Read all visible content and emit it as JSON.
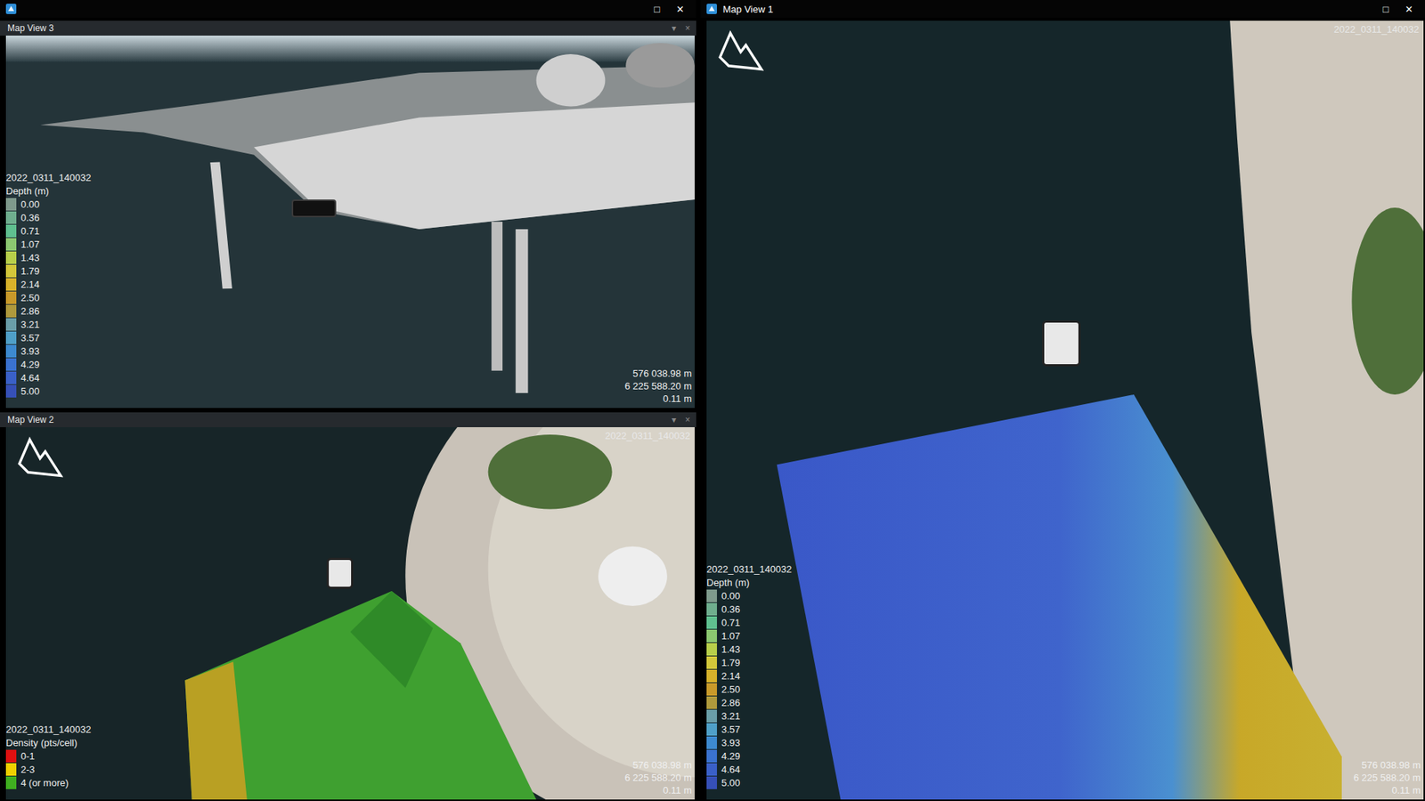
{
  "windows": [
    {
      "title": "",
      "buttons": [
        "□",
        "✕"
      ],
      "panels": [
        {
          "title": "Map View 3",
          "kind": "perspective",
          "controls": [
            "▾",
            "×"
          ],
          "top_tag": "",
          "north_arrow": false,
          "legend": {
            "dataset": "2022_0311_140032",
            "title": "Depth (m)",
            "entries": [
              {
                "label": "0.00",
                "color": "#7f9a8c"
              },
              {
                "label": "0.36",
                "color": "#6fae8e"
              },
              {
                "label": "0.71",
                "color": "#5fc08f"
              },
              {
                "label": "1.07",
                "color": "#8cc870"
              },
              {
                "label": "1.43",
                "color": "#b8cf4a"
              },
              {
                "label": "1.79",
                "color": "#d4c83a"
              },
              {
                "label": "2.14",
                "color": "#d8b22a"
              },
              {
                "label": "2.50",
                "color": "#c99a2a"
              },
              {
                "label": "2.86",
                "color": "#b09a3c"
              },
              {
                "label": "3.21",
                "color": "#6a9ea8"
              },
              {
                "label": "3.57",
                "color": "#4fa0c8"
              },
              {
                "label": "3.93",
                "color": "#3d8ad0"
              },
              {
                "label": "4.29",
                "color": "#3a72d0"
              },
              {
                "label": "4.64",
                "color": "#3a60c8"
              },
              {
                "label": "5.00",
                "color": "#3650b8"
              }
            ]
          },
          "coords": [
            "576 038.98 m",
            "6 225 588.20 m",
            "0.11 m"
          ]
        },
        {
          "title": "Map View 2",
          "kind": "plan-density",
          "controls": [
            "▾",
            "×"
          ],
          "top_tag": "2022_0311_140032",
          "north_arrow": true,
          "legend": {
            "dataset": "2022_0311_140032",
            "title": "Density (pts/cell)",
            "entries": [
              {
                "label": "0-1",
                "color": "#e01010"
              },
              {
                "label": "2-3",
                "color": "#f0d000"
              },
              {
                "label": "4 (or more)",
                "color": "#40b020"
              }
            ]
          },
          "coords": [
            "576 038.98 m",
            "6 225 588.20 m",
            "0.11 m"
          ]
        }
      ]
    },
    {
      "title": "Map View 1",
      "buttons": [
        "□",
        "✕"
      ],
      "panels": [
        {
          "title": "",
          "kind": "plan-depth",
          "controls": [],
          "top_tag": "2022_0311_140032",
          "north_arrow": true,
          "legend": {
            "dataset": "2022_0311_140032",
            "title": "Depth (m)",
            "entries": [
              {
                "label": "0.00",
                "color": "#7f9a8c"
              },
              {
                "label": "0.36",
                "color": "#6fae8e"
              },
              {
                "label": "0.71",
                "color": "#5fc08f"
              },
              {
                "label": "1.07",
                "color": "#8cc870"
              },
              {
                "label": "1.43",
                "color": "#b8cf4a"
              },
              {
                "label": "1.79",
                "color": "#d4c83a"
              },
              {
                "label": "2.14",
                "color": "#d8b22a"
              },
              {
                "label": "2.50",
                "color": "#c99a2a"
              },
              {
                "label": "2.86",
                "color": "#b09a3c"
              },
              {
                "label": "3.21",
                "color": "#6a9ea8"
              },
              {
                "label": "3.57",
                "color": "#4fa0c8"
              },
              {
                "label": "3.93",
                "color": "#3d8ad0"
              },
              {
                "label": "4.29",
                "color": "#3a72d0"
              },
              {
                "label": "4.64",
                "color": "#3a60c8"
              },
              {
                "label": "5.00",
                "color": "#3650b8"
              }
            ]
          },
          "coords": [
            "576 038.98 m",
            "6 225 588.20 m",
            "0.11 m"
          ]
        }
      ]
    }
  ]
}
